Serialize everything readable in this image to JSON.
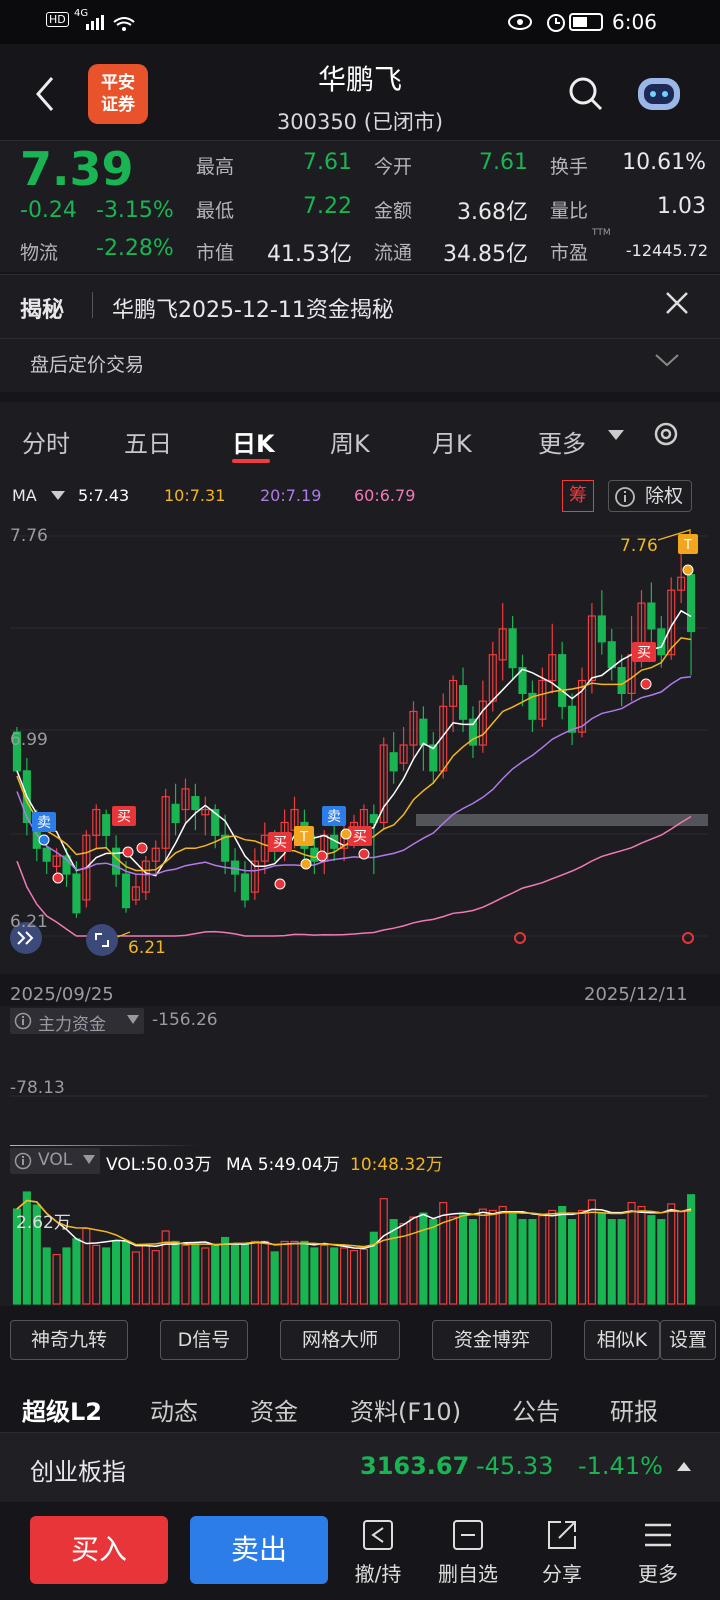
{
  "status_bar": {
    "left_icons": [
      "HD",
      "4G"
    ],
    "time": "6:06"
  },
  "header": {
    "stock_name": "华鹏飞",
    "stock_code_status": "300350 (已闭市)",
    "broker_logo_text_1": "平安",
    "broker_logo_text_2": "证券"
  },
  "quote": {
    "price": "7.39",
    "change": "-0.24",
    "change_pct": "-3.15%",
    "wuliu_label": "物流",
    "wuliu_val": "-2.28%",
    "high_label": "最高",
    "high": "7.61",
    "low_label": "最低",
    "low": "7.22",
    "mktcap_label": "市值",
    "mktcap": "41.53亿",
    "open_label": "今开",
    "open": "7.61",
    "amount_label": "金额",
    "amount": "3.68亿",
    "float_label": "流通",
    "float": "34.85亿",
    "turnover_label": "换手",
    "turnover": "10.61%",
    "volratio_label": "量比",
    "volratio": "1.03",
    "pe_label": "市盈",
    "pe_sup": "TTM",
    "pe": "-12445.72"
  },
  "reveal": {
    "tag": "揭秘",
    "text": "华鹏飞2025-12-11资金揭秘",
    "sub": "盘后定价交易"
  },
  "tabs": [
    "分时",
    "五日",
    "日K",
    "周K",
    "月K",
    "更多"
  ],
  "ma": {
    "label": "MA",
    "ma5": "5:7.43",
    "ma10": "10:7.31",
    "ma20": "20:7.19",
    "ma60": "60:6.79",
    "chou": "筹",
    "chuquan": "除权"
  },
  "chart": {
    "y_top": "7.76",
    "y_mid": "6.99",
    "y_bot": "6.21",
    "max_label": "7.76",
    "min_label": "6.21",
    "date_start": "2025/09/25",
    "date_end": "2025/12/11",
    "buy": "买",
    "sell": "卖",
    "t": "T"
  },
  "funds": {
    "label": "主力资金",
    "value": "-156.26",
    "level": "-78.13"
  },
  "vol": {
    "label": "VOL",
    "vol": "VOL:50.03万",
    "ma5": "MA 5:49.04万",
    "ma10": "10:48.32万",
    "level": "2.62万"
  },
  "tools": [
    "神奇九转",
    "D信号",
    "网格大师",
    "资金博弈",
    "相似K",
    "设置"
  ],
  "bottom_tabs": [
    "超级L2",
    "动态",
    "资金",
    "资料(F10)",
    "公告",
    "研报"
  ],
  "index": {
    "name": "创业板指",
    "value": "3163.67",
    "change": "-45.33",
    "pct": "-1.41%"
  },
  "actions": {
    "buy": "买入",
    "sell": "卖出",
    "hold": "撤/持",
    "del": "删自选",
    "share": "分享",
    "more": "更多"
  },
  "colors": {
    "up": "#f03c3c",
    "down": "#19b552",
    "ma5": "#ffffff",
    "ma10": "#f2b71f",
    "ma20": "#b07ae8",
    "ma60": "#f07ab6",
    "buy_btn": "#e8353a",
    "sell_btn": "#2d7de8"
  },
  "chart_data": {
    "type": "candlestick",
    "candles": [
      [
        7.0,
        6.85,
        7.02,
        6.85
      ],
      [
        6.85,
        6.65,
        6.9,
        6.6
      ],
      [
        6.65,
        6.55,
        6.7,
        6.5
      ],
      [
        6.55,
        6.5,
        6.6,
        6.45
      ],
      [
        6.48,
        6.52,
        6.55,
        6.45
      ],
      [
        6.52,
        6.45,
        6.55,
        6.4
      ],
      [
        6.45,
        6.3,
        6.5,
        6.28
      ],
      [
        6.35,
        6.6,
        6.62,
        6.32
      ],
      [
        6.6,
        6.7,
        6.72,
        6.55
      ],
      [
        6.68,
        6.6,
        6.7,
        6.55
      ],
      [
        6.55,
        6.45,
        6.6,
        6.4
      ],
      [
        6.45,
        6.32,
        6.5,
        6.3
      ],
      [
        6.35,
        6.4,
        6.45,
        6.33
      ],
      [
        6.38,
        6.5,
        6.52,
        6.35
      ],
      [
        6.5,
        6.55,
        6.58,
        6.45
      ],
      [
        6.55,
        6.75,
        6.78,
        6.5
      ],
      [
        6.72,
        6.65,
        6.8,
        6.6
      ],
      [
        6.7,
        6.78,
        6.82,
        6.65
      ],
      [
        6.75,
        6.7,
        6.8,
        6.62
      ],
      [
        6.68,
        6.7,
        6.75,
        6.6
      ],
      [
        6.7,
        6.6,
        6.72,
        6.55
      ],
      [
        6.6,
        6.5,
        6.68,
        6.45
      ],
      [
        6.5,
        6.45,
        6.55,
        6.38
      ],
      [
        6.45,
        6.35,
        6.5,
        6.32
      ],
      [
        6.38,
        6.5,
        6.55,
        6.35
      ],
      [
        6.5,
        6.6,
        6.65,
        6.45
      ],
      [
        6.58,
        6.55,
        6.62,
        6.5
      ],
      [
        6.55,
        6.65,
        6.7,
        6.5
      ],
      [
        6.62,
        6.7,
        6.75,
        6.55
      ],
      [
        6.65,
        6.55,
        6.7,
        6.5
      ],
      [
        6.55,
        6.5,
        6.6,
        6.45
      ],
      [
        6.5,
        6.6,
        6.62,
        6.45
      ],
      [
        6.6,
        6.55,
        6.65,
        6.5
      ],
      [
        6.55,
        6.6,
        6.65,
        6.5
      ],
      [
        6.6,
        6.65,
        6.68,
        6.55
      ],
      [
        6.62,
        6.7,
        6.72,
        6.58
      ],
      [
        6.68,
        6.65,
        6.72,
        6.45
      ],
      [
        6.65,
        6.95,
        6.98,
        6.62
      ],
      [
        6.92,
        6.85,
        7.0,
        6.8
      ],
      [
        6.88,
        6.95,
        7.02,
        6.85
      ],
      [
        6.95,
        7.08,
        7.12,
        6.9
      ],
      [
        7.05,
        6.95,
        7.1,
        6.85
      ],
      [
        6.95,
        6.85,
        7.0,
        6.8
      ],
      [
        6.85,
        7.1,
        7.15,
        6.82
      ],
      [
        7.1,
        7.2,
        7.22,
        7.0
      ],
      [
        7.18,
        7.05,
        7.25,
        7.0
      ],
      [
        7.05,
        6.95,
        7.1,
        6.9
      ],
      [
        6.95,
        7.12,
        7.2,
        6.92
      ],
      [
        7.12,
        7.3,
        7.35,
        7.08
      ],
      [
        7.28,
        7.4,
        7.5,
        7.2
      ],
      [
        7.4,
        7.25,
        7.45,
        7.2
      ],
      [
        7.25,
        7.15,
        7.3,
        7.1
      ],
      [
        7.15,
        7.05,
        7.2,
        7.0
      ],
      [
        7.05,
        7.2,
        7.25,
        7.02
      ],
      [
        7.2,
        7.3,
        7.42,
        7.15
      ],
      [
        7.3,
        7.1,
        7.35,
        7.05
      ],
      [
        7.1,
        7.0,
        7.15,
        6.95
      ],
      [
        7.0,
        7.2,
        7.25,
        6.98
      ],
      [
        7.2,
        7.45,
        7.5,
        7.15
      ],
      [
        7.45,
        7.35,
        7.55,
        7.3
      ],
      [
        7.35,
        7.25,
        7.4,
        7.2
      ],
      [
        7.25,
        7.15,
        7.3,
        7.1
      ],
      [
        7.15,
        7.3,
        7.45,
        7.12
      ],
      [
        7.3,
        7.5,
        7.55,
        7.25
      ],
      [
        7.5,
        7.4,
        7.58,
        7.35
      ],
      [
        7.4,
        7.3,
        7.45,
        7.25
      ],
      [
        7.3,
        7.55,
        7.6,
        7.28
      ],
      [
        7.55,
        7.6,
        7.76,
        7.5
      ],
      [
        7.61,
        7.39,
        7.61,
        7.22
      ]
    ]
  }
}
